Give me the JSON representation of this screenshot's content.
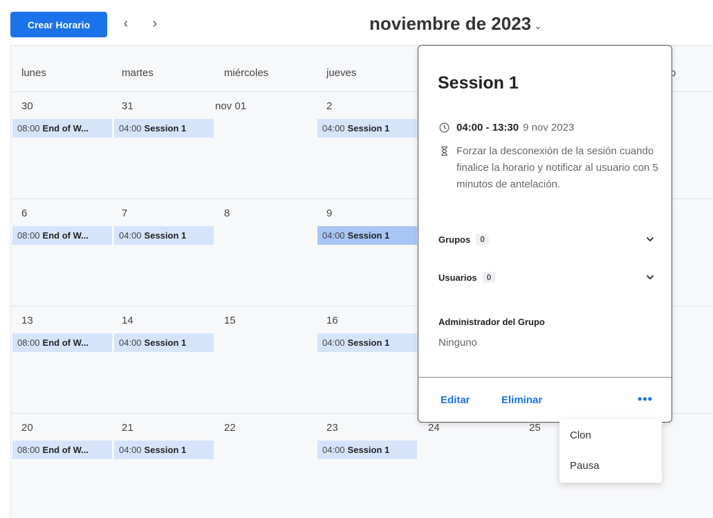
{
  "toolbar": {
    "create_label": "Crear Horario",
    "prev_glyph": "‹",
    "next_glyph": "›",
    "month_title": "noviembre de 2023",
    "month_chevron": "⌄"
  },
  "calendar": {
    "weekdays": [
      "lunes",
      "martes",
      "miércoles",
      "jueves"
    ],
    "weekday_partial": "o",
    "weeks": [
      {
        "days": [
          "30",
          "31",
          "nov 01",
          "2"
        ],
        "events": [
          {
            "time": "08:00",
            "title": "End of W..."
          },
          {
            "time": "04:00",
            "title": "Session 1"
          },
          {
            "time": "04:00",
            "title": "Session 1"
          }
        ]
      },
      {
        "days": [
          "6",
          "7",
          "8",
          "9"
        ],
        "events": [
          {
            "time": "08:00",
            "title": "End of W..."
          },
          {
            "time": "04:00",
            "title": "Session 1"
          },
          {
            "time": "04:00",
            "title": "Session 1"
          }
        ]
      },
      {
        "days": [
          "13",
          "14",
          "15",
          "16"
        ],
        "events": [
          {
            "time": "08:00",
            "title": "End of W..."
          },
          {
            "time": "04:00",
            "title": "Session 1"
          },
          {
            "time": "04:00",
            "title": "Session 1"
          }
        ]
      },
      {
        "days": [
          "20",
          "21",
          "22",
          "23",
          "24",
          "25"
        ],
        "events": [
          {
            "time": "08:00",
            "title": "End of W..."
          },
          {
            "time": "04:00",
            "title": "Session 1"
          },
          {
            "time": "04:00",
            "title": "Session 1"
          }
        ]
      }
    ]
  },
  "popover": {
    "title": "Session 1",
    "time_range": "04:00 - 13:30",
    "date": "9 nov 2023",
    "notice": "Forzar la desconexión de la sesión cuando finalice la horario y notificar al usuario con 5 minutos de antelación.",
    "groups_label": "Grupos",
    "groups_count": "0",
    "users_label": "Usuarios",
    "users_count": "0",
    "admin_label": "Administrador del Grupo",
    "admin_value": "Ninguno",
    "edit_label": "Editar",
    "delete_label": "Eliminar",
    "more_glyph": "•••"
  },
  "menu": {
    "clone_label": "Clon",
    "pause_label": "Pausa"
  },
  "colors": {
    "accent": "#1a73e8",
    "event_bg": "#d6e4fb",
    "event_active_bg": "#a8c6f5"
  }
}
